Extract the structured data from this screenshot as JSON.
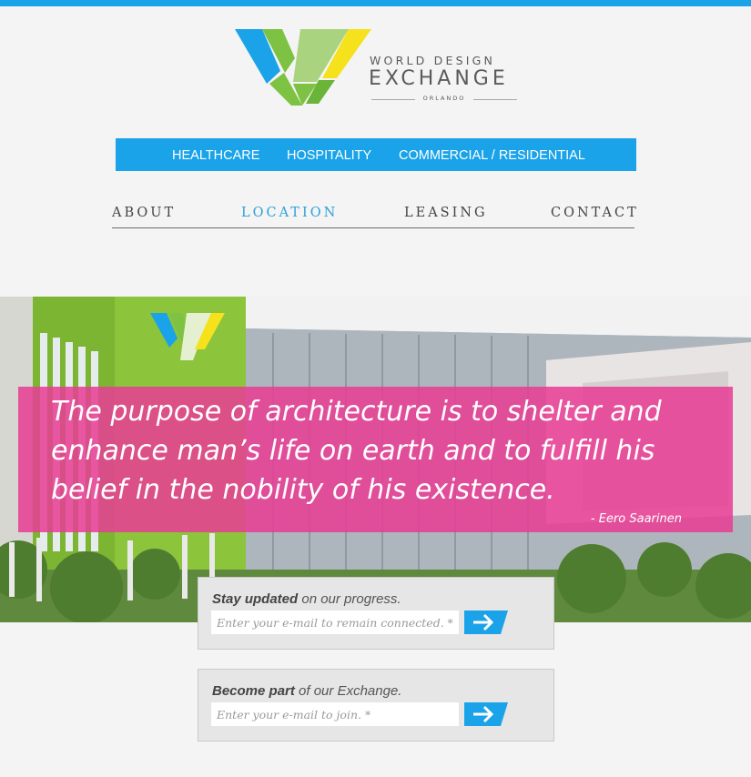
{
  "logo": {
    "line1": "WORLD DESIGN",
    "line2": "EXCHANGE",
    "line3": "ORLANDO"
  },
  "category_nav": {
    "items": [
      {
        "label": "HEALTHCARE"
      },
      {
        "label": "HOSPITALITY"
      },
      {
        "label": "COMMERCIAL / RESIDENTIAL"
      }
    ]
  },
  "main_nav": {
    "items": [
      {
        "label": "ABOUT",
        "active": false
      },
      {
        "label": "LOCATION",
        "active": true
      },
      {
        "label": "LEASING",
        "active": false
      },
      {
        "label": "CONTACT",
        "active": false
      }
    ]
  },
  "hero": {
    "quote": "The purpose of architecture is to shelter and enhance man’s life on earth and to fulfill his belief in the nobility of his existence.",
    "author": "- Eero Saarinen"
  },
  "signup_updates": {
    "label_bold": "Stay updated",
    "label_rest": " on our progress.",
    "placeholder": "Enter your e-mail to remain connected. *",
    "button_icon": "arrow-right-icon"
  },
  "signup_join": {
    "label_bold": "Become part",
    "label_rest": " of our Exchange.",
    "placeholder": "Enter your e-mail to join. *",
    "button_icon": "arrow-right-icon"
  },
  "colors": {
    "accent_blue": "#1aa3e8",
    "quote_pink": "#e83c94",
    "logo_green": "#7dc242",
    "logo_yellow": "#f5e21c",
    "logo_lightgreen": "#a9d37e"
  }
}
